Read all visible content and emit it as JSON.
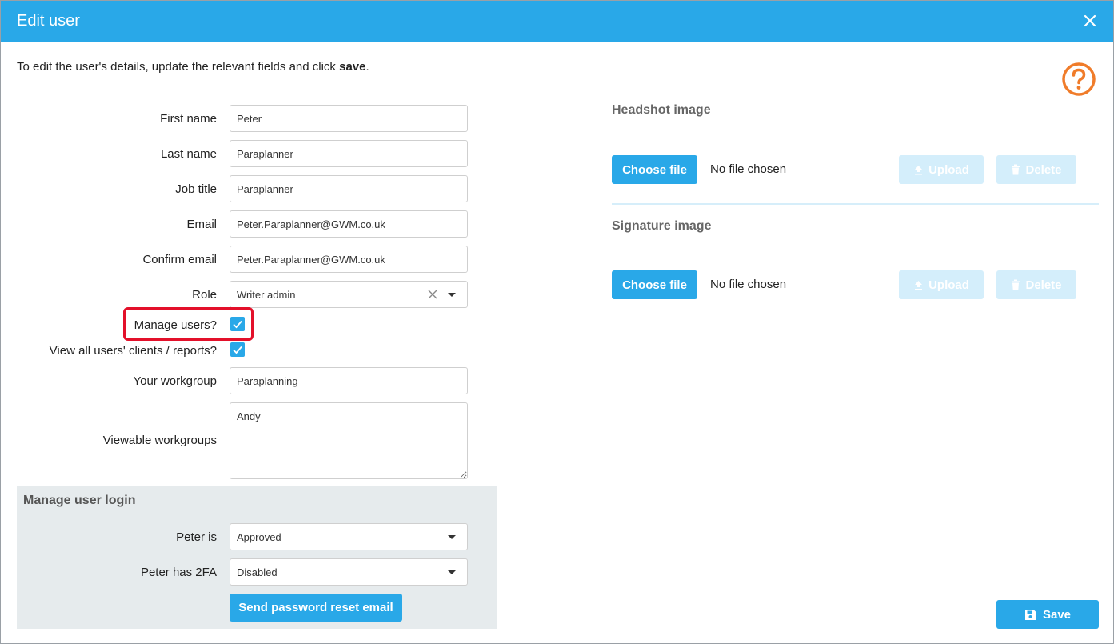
{
  "dialog": {
    "title": "Edit user",
    "intro_text": "To edit the user's details, update the relevant fields and click ",
    "intro_bold": "save",
    "intro_end": "."
  },
  "form": {
    "first_name": {
      "label": "First name",
      "value": "Peter"
    },
    "last_name": {
      "label": "Last name",
      "value": "Paraplanner"
    },
    "job_title": {
      "label": "Job title",
      "value": "Paraplanner"
    },
    "email": {
      "label": "Email",
      "value": "Peter.Paraplanner@GWM.co.uk"
    },
    "confirm_email": {
      "label": "Confirm email",
      "value": "Peter.Paraplanner@GWM.co.uk"
    },
    "role": {
      "label": "Role",
      "value": "Writer admin"
    },
    "manage_users": {
      "label": "Manage users?",
      "checked": true
    },
    "view_all": {
      "label": "View all users' clients / reports?",
      "checked": true
    },
    "workgroup": {
      "label": "Your workgroup",
      "value": "Paraplanning"
    },
    "viewable_workgroups": {
      "label": "Viewable workgroups",
      "value": "Andy"
    }
  },
  "login": {
    "title": "Manage user login",
    "status": {
      "label": "Peter is",
      "value": "Approved"
    },
    "twofa": {
      "label": "Peter has 2FA",
      "value": "Disabled"
    },
    "reset_button": "Send password reset email"
  },
  "headshot": {
    "title": "Headshot image",
    "choose_label": "Choose file",
    "file_status": "No file chosen",
    "upload_label": "Upload",
    "delete_label": "Delete"
  },
  "signature": {
    "title": "Signature image",
    "choose_label": "Choose file",
    "file_status": "No file chosen",
    "upload_label": "Upload",
    "delete_label": "Delete"
  },
  "save_label": "Save",
  "colors": {
    "accent": "#29a8e8",
    "help": "#f07c2a",
    "highlight": "#e3102a"
  }
}
